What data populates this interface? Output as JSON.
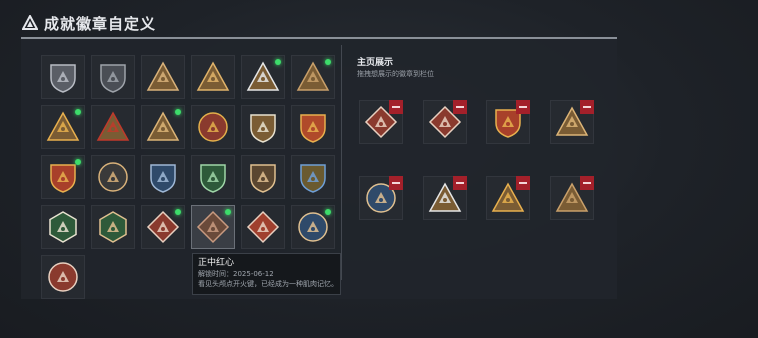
{
  "header": {
    "title": "成就徽章自定义"
  },
  "badges": [
    {
      "id": "b1",
      "shape": "shield",
      "color": "#5a5e66",
      "accent": "#b8bcc4",
      "dot": false
    },
    {
      "id": "b2",
      "shape": "shield",
      "color": "#4a4e55",
      "accent": "#9ea3aa",
      "dot": false
    },
    {
      "id": "b3",
      "shape": "triangle",
      "color": "#7a5c34",
      "accent": "#d9b27a",
      "dot": false
    },
    {
      "id": "b4",
      "shape": "triangle",
      "color": "#7a5c34",
      "accent": "#e0b36a",
      "dot": false
    },
    {
      "id": "b5",
      "shape": "triangle",
      "color": "#7a5c34",
      "accent": "#e6e6e6",
      "dot": true
    },
    {
      "id": "b6",
      "shape": "triangle",
      "color": "#7a5c34",
      "accent": "#c9a06a",
      "dot": true
    },
    {
      "id": "b7",
      "shape": "triangle",
      "color": "#7a5c34",
      "accent": "#e8b04e",
      "dot": true
    },
    {
      "id": "b8",
      "shape": "triangle",
      "color": "#7a5c34",
      "accent": "#c0392b",
      "dot": false
    },
    {
      "id": "b9",
      "shape": "triangle",
      "color": "#7a5c34",
      "accent": "#dcb477",
      "dot": true
    },
    {
      "id": "b10",
      "shape": "circle",
      "color": "#8a3a2e",
      "accent": "#e3b04b",
      "dot": false
    },
    {
      "id": "b11",
      "shape": "shield",
      "color": "#7a5c34",
      "accent": "#e8e2d0",
      "dot": false
    },
    {
      "id": "b12",
      "shape": "shield",
      "color": "#b04a2a",
      "accent": "#e8b04e",
      "dot": false
    },
    {
      "id": "b13",
      "shape": "shield",
      "color": "#a8402a",
      "accent": "#e8b04e",
      "dot": true
    },
    {
      "id": "b14",
      "shape": "circle",
      "color": "#3a3a3a",
      "accent": "#d9b27a",
      "dot": false
    },
    {
      "id": "b15",
      "shape": "shield",
      "color": "#2f4a6a",
      "accent": "#9fb8d6",
      "dot": false
    },
    {
      "id": "b16",
      "shape": "shield",
      "color": "#2e5a3a",
      "accent": "#9fd6a8",
      "dot": false
    },
    {
      "id": "b17",
      "shape": "shield",
      "color": "#5a4630",
      "accent": "#e0c090",
      "dot": false
    },
    {
      "id": "b18",
      "shape": "shield",
      "color": "#6a5a30",
      "accent": "#6f9fd6",
      "dot": false
    },
    {
      "id": "b19",
      "shape": "hexagon",
      "color": "#2e5a3a",
      "accent": "#e8e2d0",
      "dot": false
    },
    {
      "id": "b20",
      "shape": "hexagon",
      "color": "#2e5a3a",
      "accent": "#e0c090",
      "dot": false
    },
    {
      "id": "b21",
      "shape": "diamond",
      "color": "#8a3a2e",
      "accent": "#e8d0c0",
      "dot": true
    },
    {
      "id": "b22",
      "shape": "diamond",
      "color": "#6a4a3a",
      "accent": "#c89a80",
      "dot": true,
      "selected": true
    },
    {
      "id": "b23",
      "shape": "diamond",
      "color": "#a0402e",
      "accent": "#e8d0c0",
      "dot": false
    },
    {
      "id": "b24",
      "shape": "circle",
      "color": "#2f4a6a",
      "accent": "#e0c090",
      "dot": true
    },
    {
      "id": "b25",
      "shape": "circle",
      "color": "#8a3a2e",
      "accent": "#e8d0c0",
      "dot": false
    }
  ],
  "tooltip": {
    "name": "正中红心",
    "date_label": "解锁时间：",
    "date": "2025-06-12",
    "desc": "看见头颅点开火键，已经成为一种肌肉记忆。"
  },
  "showcase": {
    "title": "主页展示",
    "subtitle": "拖拽想展示的徽章到栏位",
    "slots": [
      {
        "shape": "diamond",
        "color": "#8a3a2e",
        "accent": "#e8d0c0"
      },
      {
        "shape": "diamond",
        "color": "#8a3a2e",
        "accent": "#e8d0c0"
      },
      {
        "shape": "shield",
        "color": "#a8402a",
        "accent": "#e8b04e"
      },
      {
        "shape": "triangle",
        "color": "#7a5c34",
        "accent": "#dcb477"
      },
      {
        "shape": "circle",
        "color": "#2f4a6a",
        "accent": "#e0c090"
      },
      {
        "shape": "triangle",
        "color": "#7a5c34",
        "accent": "#e6e6e6"
      },
      {
        "shape": "triangle",
        "color": "#7a5c34",
        "accent": "#e8b04e"
      },
      {
        "shape": "triangle",
        "color": "#7a5c34",
        "accent": "#c9a06a"
      }
    ]
  }
}
